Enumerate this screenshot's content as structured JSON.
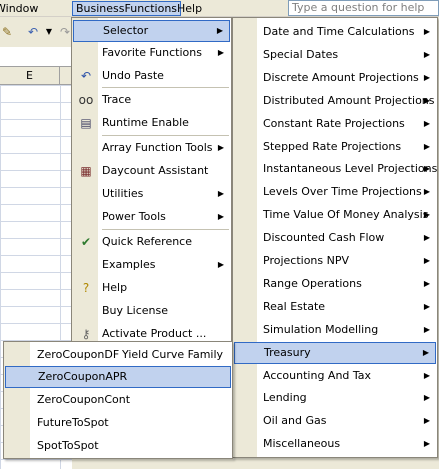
{
  "menubar": {
    "window": "Window",
    "business_functions": "BusinessFunctions",
    "help": "Help",
    "question_placeholder": "Type a question for help"
  },
  "sheet": {
    "column_e": "E"
  },
  "main_menu": {
    "items": [
      {
        "label": "Selector",
        "icon": "none",
        "submenu": true,
        "highlighted": true
      },
      {
        "label": "Favorite Functions",
        "icon": "none",
        "submenu": true
      },
      {
        "label": "Undo Paste",
        "icon": "undo-icon"
      },
      {
        "label": "Trace",
        "icon": "glasses-icon"
      },
      {
        "label": "Runtime Enable",
        "icon": "printer-icon"
      },
      {
        "label": "Array Function Tools",
        "icon": "none",
        "submenu": true
      },
      {
        "label": "Daycount Assistant",
        "icon": "calendar-icon"
      },
      {
        "label": "Utilities",
        "icon": "none",
        "submenu": true
      },
      {
        "label": "Power Tools",
        "icon": "none",
        "submenu": true
      },
      {
        "label": "Quick Reference",
        "icon": "checklist-icon"
      },
      {
        "label": "Examples",
        "icon": "none",
        "submenu": true
      },
      {
        "label": "Help",
        "icon": "question-bulb-icon"
      },
      {
        "label": "Buy License",
        "icon": "none"
      },
      {
        "label": "Activate Product ...",
        "icon": "key-icon"
      }
    ]
  },
  "selector_menu": {
    "items": [
      {
        "label": "Date and Time Calculations"
      },
      {
        "label": "Special Dates"
      },
      {
        "label": "Discrete Amount Projections"
      },
      {
        "label": "Distributed Amount Projections"
      },
      {
        "label": "Constant Rate Projections"
      },
      {
        "label": "Stepped Rate Projections"
      },
      {
        "label": "Instantaneous Level Projections"
      },
      {
        "label": "Levels Over Time Projections"
      },
      {
        "label": "Time Value Of Money Analysis"
      },
      {
        "label": "Discounted Cash Flow"
      },
      {
        "label": "Projections NPV"
      },
      {
        "label": "Range Operations"
      },
      {
        "label": "Real Estate"
      },
      {
        "label": "Simulation Modelling"
      },
      {
        "label": "Treasury",
        "highlighted": true
      },
      {
        "label": "Accounting And Tax"
      },
      {
        "label": "Lending"
      },
      {
        "label": "Oil and Gas"
      },
      {
        "label": "Miscellaneous"
      }
    ]
  },
  "treasury_menu": {
    "yield_curve_family": "Yield Curve Family",
    "items": [
      {
        "label": "ZeroCouponDF"
      },
      {
        "label": "ZeroCouponAPR",
        "highlighted": true
      },
      {
        "label": "ZeroCouponCont"
      },
      {
        "label": "FutureToSpot"
      },
      {
        "label": "SpotToSpot"
      }
    ]
  },
  "colors": {
    "highlight_bg": "#c1d2ee",
    "highlight_border": "#316ac5",
    "menu_gutter": "#ece9d8"
  }
}
